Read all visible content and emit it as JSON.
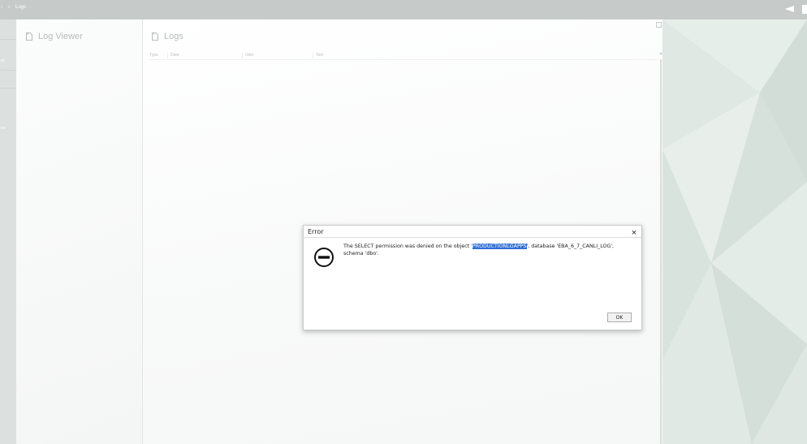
{
  "topbar": {
    "breadcrumb_home": "›",
    "breadcrumb_sep": "›",
    "breadcrumb_current": "Logs"
  },
  "left_strip": {
    "item_1": "sk",
    "item_2": "ns"
  },
  "left_panel": {
    "title": "Log Viewer"
  },
  "main_panel": {
    "title": "Logs",
    "columns": [
      "Type",
      "Date",
      "User",
      "Text"
    ]
  },
  "dialog": {
    "title": "Error",
    "close_label": "×",
    "message_before": "The SELECT permission was denied on the object '",
    "message_object": "PRODUCTIONLGAPPS",
    "message_after": "', database 'EBA_6_7_CANLI_LOG', schema 'dbo'.",
    "ok_label": "OK"
  },
  "colors": {
    "highlight": "#2f6fd6",
    "topbar": "#c6cbc9",
    "right_region": "#dde7e2"
  }
}
